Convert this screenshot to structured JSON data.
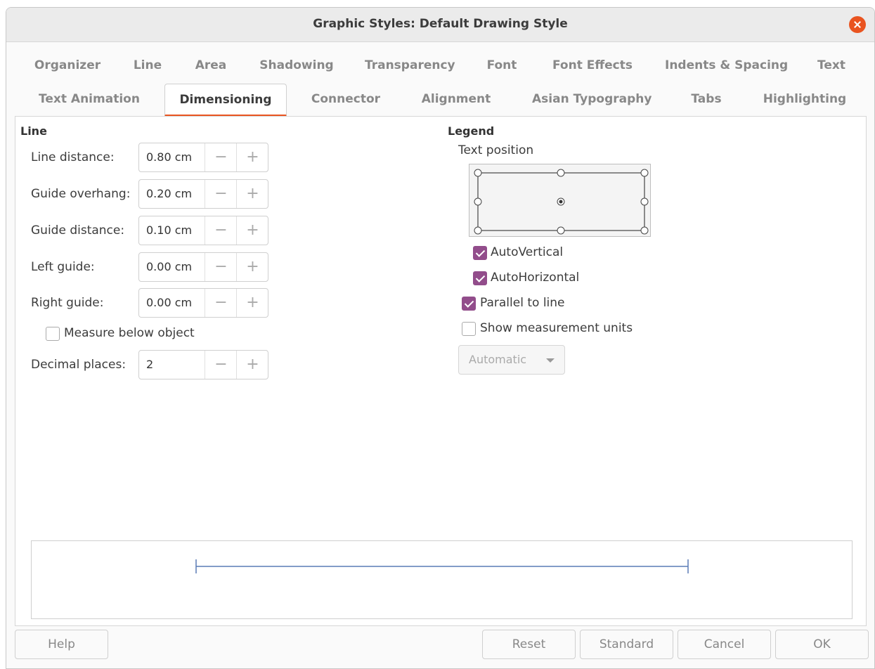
{
  "window": {
    "title": "Graphic Styles: Default Drawing Style"
  },
  "tabs_row1": [
    "Organizer",
    "Line",
    "Area",
    "Shadowing",
    "Transparency",
    "Font",
    "Font Effects",
    "Indents & Spacing",
    "Text"
  ],
  "tabs_row2": [
    "Text Animation",
    "Dimensioning",
    "Connector",
    "Alignment",
    "Asian Typography",
    "Tabs",
    "Highlighting"
  ],
  "active_tab": "Dimensioning",
  "line": {
    "title": "Line",
    "line_distance": {
      "label": "Line distance:",
      "value": "0.80 cm"
    },
    "guide_overhang": {
      "label": "Guide overhang:",
      "value": "0.20 cm"
    },
    "guide_distance": {
      "label": "Guide distance:",
      "value": "0.10 cm"
    },
    "left_guide": {
      "label": "Left guide:",
      "value": "0.00 cm"
    },
    "right_guide": {
      "label": "Right guide:",
      "value": "0.00 cm"
    },
    "measure_below": {
      "label": "Measure below object",
      "checked": false
    },
    "decimal_places": {
      "label": "Decimal places:",
      "value": "2"
    }
  },
  "spin_minus": "−",
  "spin_plus": "+",
  "legend": {
    "title": "Legend",
    "text_position_label": "Text position",
    "auto_vertical": {
      "label": "AutoVertical",
      "checked": true
    },
    "auto_horizontal": {
      "label": "AutoHorizontal",
      "checked": true
    },
    "parallel_to_line": {
      "label": "Parallel to line",
      "checked": true
    },
    "show_units": {
      "label": "Show measurement units",
      "checked": false
    },
    "units_dropdown": "Automatic"
  },
  "buttons": {
    "help": "Help",
    "reset": "Reset",
    "standard": "Standard",
    "cancel": "Cancel",
    "ok": "OK"
  },
  "colors": {
    "accent": "#e95420",
    "checkbox": "#924d8b",
    "preview_line": "#5a7bb5"
  }
}
